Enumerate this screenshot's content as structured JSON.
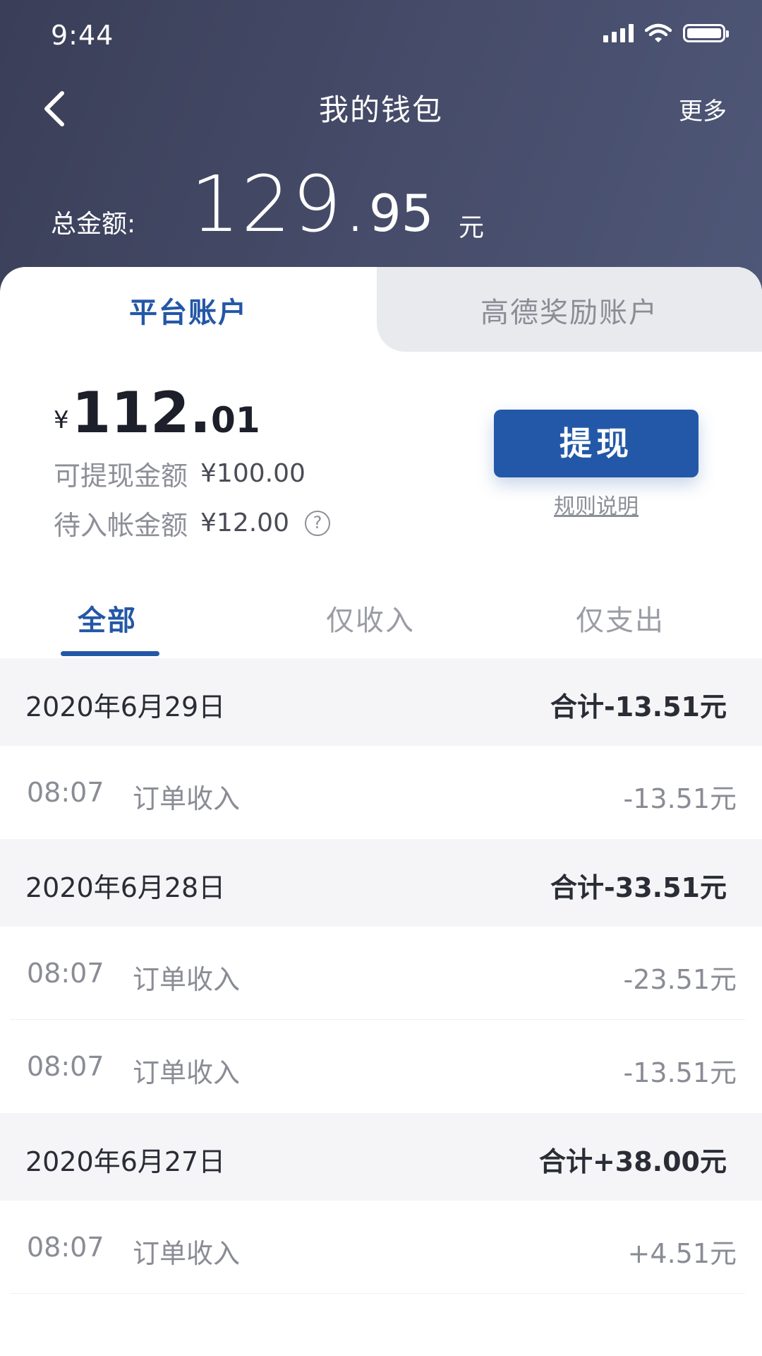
{
  "status_bar": {
    "time": "9:44"
  },
  "nav": {
    "title": "我的钱包",
    "more": "更多"
  },
  "total": {
    "label": "总金额:",
    "integer": "129.",
    "decimal": "95",
    "unit": "元"
  },
  "account_tabs": [
    {
      "label": "平台账户",
      "active": true
    },
    {
      "label": "高德奖励账户",
      "active": false
    }
  ],
  "balance": {
    "currency": "¥",
    "integer": "112.",
    "decimal": "01",
    "withdrawable_label": "可提现金额",
    "withdrawable_value": "¥100.00",
    "pending_label": "待入帐金额",
    "pending_value": "¥12.00",
    "help_glyph": "?",
    "withdraw_button": "提现",
    "rules_link": "规则说明"
  },
  "filter_tabs": [
    {
      "label": "全部",
      "active": true
    },
    {
      "label": "仅收入",
      "active": false
    },
    {
      "label": "仅支出",
      "active": false
    }
  ],
  "days": [
    {
      "date": "2020年6月29日",
      "total": "合计-13.51元",
      "items": [
        {
          "time": "08:07",
          "desc": "订单收入",
          "amount": "-13.51元"
        }
      ]
    },
    {
      "date": "2020年6月28日",
      "total": "合计-33.51元",
      "items": [
        {
          "time": "08:07",
          "desc": "订单收入",
          "amount": "-23.51元"
        },
        {
          "time": "08:07",
          "desc": "订单收入",
          "amount": "-13.51元"
        }
      ]
    },
    {
      "date": "2020年6月27日",
      "total": "合计+38.00元",
      "items": [
        {
          "time": "08:07",
          "desc": "订单收入",
          "amount": "+4.51元"
        }
      ]
    }
  ],
  "colors": {
    "header_gradient_start": "#3a3e58",
    "header_gradient_end": "#4f5778",
    "accent_blue": "#2457a6",
    "button_blue": "#2358a8",
    "muted_text": "#8d8f98",
    "day_header_bg": "#f5f5f7"
  },
  "icons": {
    "back": "chevron-left-icon",
    "signal": "signal-icon",
    "wifi": "wifi-icon",
    "battery": "battery-icon",
    "help": "question-circle-icon"
  }
}
